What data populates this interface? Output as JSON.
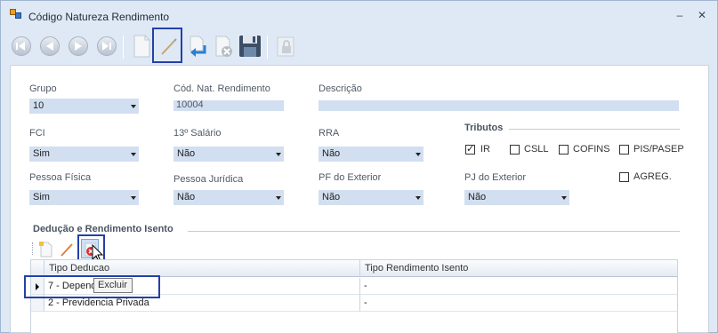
{
  "window": {
    "title": "Código Natureza Rendimento",
    "minimize_glyph": "–",
    "close_glyph": "✕"
  },
  "toolbar": {
    "buttons": [
      "first-record-icon",
      "previous-record-icon",
      "next-record-icon",
      "last-record-icon",
      "new-record-icon",
      "edit-icon",
      "undo-icon",
      "delete-icon",
      "save-icon",
      "lock-icon"
    ]
  },
  "form": {
    "grupo": {
      "label": "Grupo",
      "value": "10"
    },
    "cod_nat": {
      "label": "Cód. Nat. Rendimento",
      "value": "10004"
    },
    "descricao": {
      "label": "Descrição",
      "value": ""
    },
    "fci": {
      "label": "FCI",
      "value": "Sim"
    },
    "decimo": {
      "label": "13º Salário",
      "value": "Não"
    },
    "rra": {
      "label": "RRA",
      "value": "Não"
    },
    "pessoa_fisica": {
      "label": "Pessoa Física",
      "value": "Sim"
    },
    "pessoa_juridica": {
      "label": "Pessoa Jurídica",
      "value": "Não"
    },
    "pf_exterior": {
      "label": "PF do Exterior",
      "value": "Não"
    },
    "pj_exterior": {
      "label": "PJ do Exterior",
      "value": "Não"
    }
  },
  "tributos": {
    "title": "Tributos",
    "items": [
      {
        "label": "IR",
        "checked": true,
        "check_glyph": "✓"
      },
      {
        "label": "CSLL",
        "checked": false
      },
      {
        "label": "COFINS",
        "checked": false
      },
      {
        "label": "PIS/PASEP",
        "checked": false
      },
      {
        "label": "AGREG.",
        "checked": false
      }
    ]
  },
  "deducao": {
    "title": "Dedução e Rendimento Isento",
    "columns": [
      "Tipo Deducao",
      "Tipo Rendimento Isento"
    ],
    "rows": [
      {
        "tipo_deducao": "7 - Depend",
        "tipo_rendimento": "-"
      },
      {
        "tipo_deducao": "2 - Previdencia Privada",
        "tipo_rendimento": "-"
      }
    ],
    "tooltip": "Excluir"
  },
  "colors": {
    "highlight": "#2440a8",
    "field_bg": "#d2dff0",
    "window_bg": "#dfe9f5"
  }
}
